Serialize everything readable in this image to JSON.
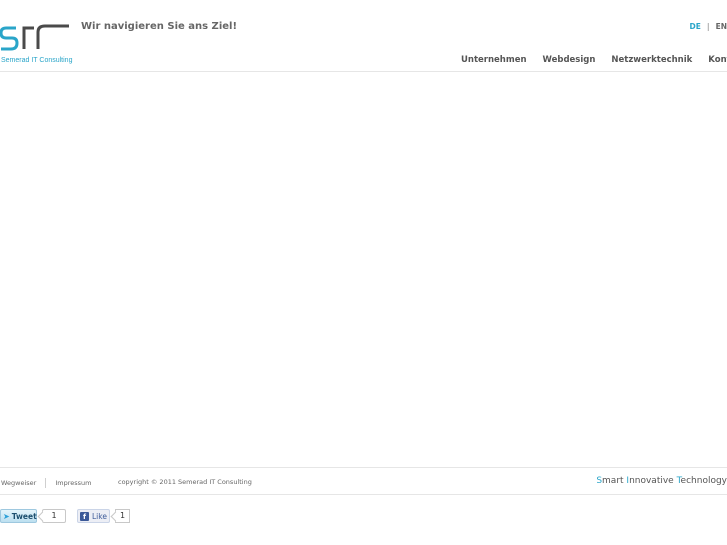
{
  "header": {
    "logo_caption": "Semerad IT Consulting",
    "tagline": "Wir navigieren Sie ans Ziel!",
    "lang": {
      "de": "DE",
      "separator": "|",
      "en": "EN"
    },
    "nav": [
      "Unternehmen",
      "Webdesign",
      "Netzwerktechnik",
      "Kontakt"
    ]
  },
  "footer": {
    "links": [
      "Wegweiser",
      "Impressum"
    ],
    "copyright": "copyright © 2011 Semerad IT Consulting",
    "slogan": {
      "s1": "S",
      "s2": "mart ",
      "i1": "I",
      "i2": "nnovative ",
      "t1": "T",
      "t2": "echnology"
    }
  },
  "social": {
    "tweet_label": "Tweet",
    "tweet_count": "1",
    "like_label": "Like",
    "like_count": "1"
  },
  "colors": {
    "accent": "#2aa5c9",
    "text": "#555555"
  }
}
